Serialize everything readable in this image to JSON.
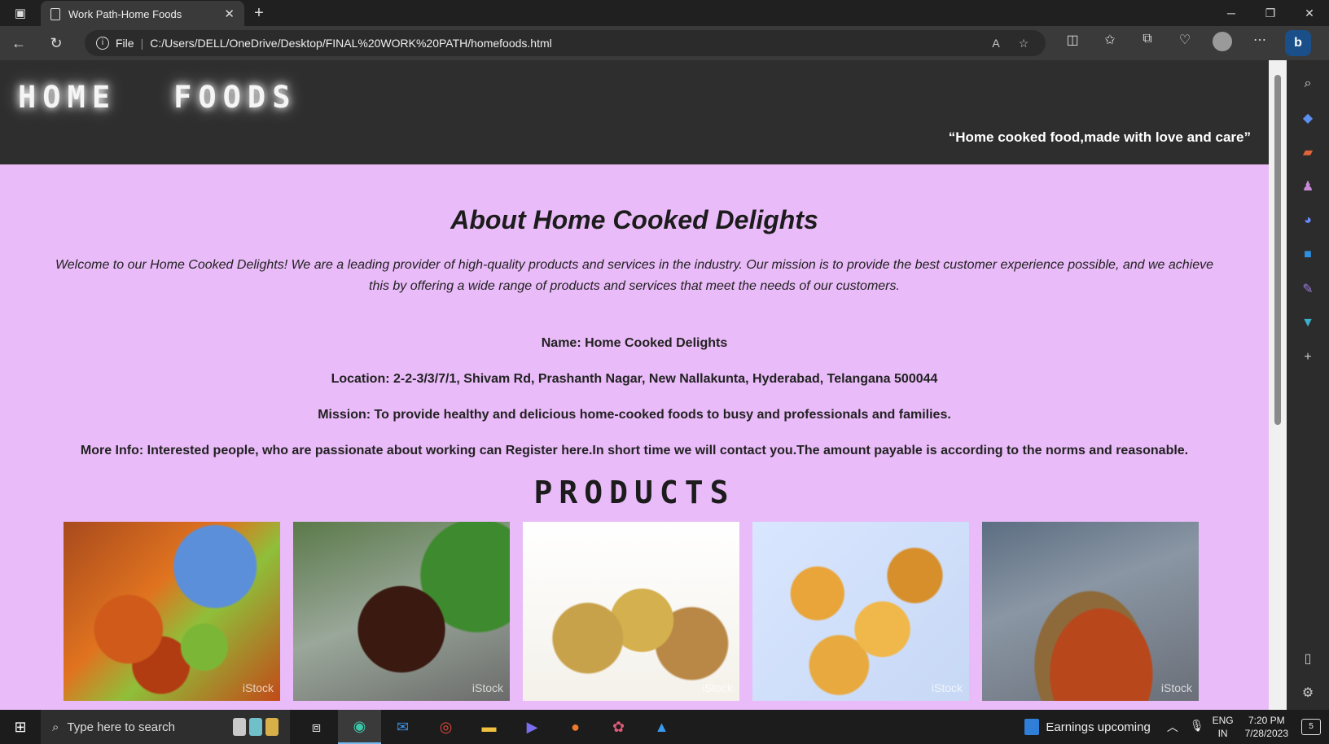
{
  "browser": {
    "tab_title": "Work Path-Home Foods",
    "tab_close": "✕",
    "new_tab": "+",
    "window_controls": {
      "minimize": "─",
      "restore": "❐",
      "close": "✕"
    },
    "url_scheme_label": "File",
    "url": "C:/Users/DELL/OneDrive/Desktop/FINAL%20WORK%20PATH/homefoods.html",
    "icons": [
      "back-icon",
      "refresh-icon",
      "info-icon",
      "read-aloud-icon",
      "favorite-star-icon",
      "split-screen-icon",
      "favorites-icon",
      "collections-icon",
      "browser-essentials-icon",
      "profile-avatar",
      "more-icon",
      "bing-icon"
    ]
  },
  "site": {
    "logo_word1": "HOME",
    "logo_word2": "FOODS",
    "tagline": "“Home cooked food,made with love and care”"
  },
  "about": {
    "heading": "About Home Cooked Delights",
    "intro": "Welcome to our Home Cooked Delights! We are a leading provider of high-quality products and services in the industry. Our mission is to provide the best customer experience possible, and we achieve this by offering a wide range of products and services that meet the needs of our customers.",
    "name": "Name: Home Cooked Delights",
    "location": "Location: 2-2-3/3/7/1, Shivam Rd, Prashanth Nagar, New Nallakunta, Hyderabad, Telangana 500044",
    "mission": "Mission: To provide healthy and delicious home-cooked foods to busy and professionals and families.",
    "more_info": "More Info: Interested people, who are passionate about working can Register here.In short time we will contact you.The amount payable is according to the norms and reasonable."
  },
  "products": {
    "heading": "PRODUCTS",
    "watermark": "iStock",
    "items": [
      "mango-pickle-image",
      "jar-pickle-image",
      "namkeen-snacks-image",
      "banana-chips-image",
      "halwa-dessert-image"
    ]
  },
  "taskbar": {
    "search_placeholder": "Type here to search",
    "news_label": "Earnings upcoming",
    "lang_line1": "ENG",
    "lang_line2": "IN",
    "time": "7:20 PM",
    "date": "7/28/2023",
    "notification_count": "5"
  }
}
